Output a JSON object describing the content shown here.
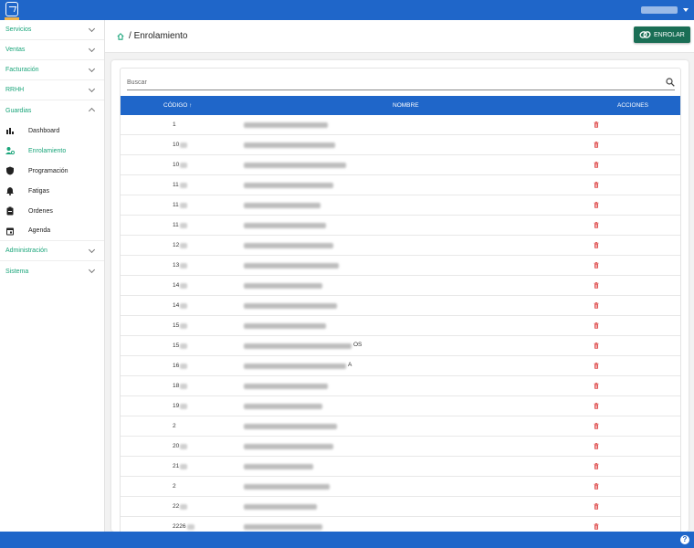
{
  "topbar": {
    "logo": "app-logo",
    "user_menu": "user-menu"
  },
  "sidebar": {
    "items": [
      {
        "label": "Servicios",
        "expanded": false
      },
      {
        "label": "Ventas",
        "expanded": false
      },
      {
        "label": "Facturación",
        "expanded": false
      },
      {
        "label": "RRHH",
        "expanded": false
      },
      {
        "label": "Guardias",
        "expanded": true
      },
      {
        "label": "Administración",
        "expanded": false
      },
      {
        "label": "Sistema",
        "expanded": false
      }
    ],
    "guardias_sub": [
      {
        "label": "Dashboard",
        "icon": "bar-chart-icon"
      },
      {
        "label": "Enrolamiento",
        "icon": "user-link-icon",
        "active": true
      },
      {
        "label": "Programación",
        "icon": "shield-icon"
      },
      {
        "label": "Fatigas",
        "icon": "bell-icon"
      },
      {
        "label": "Ordenes",
        "icon": "clipboard-icon"
      },
      {
        "label": "Agenda",
        "icon": "calendar-icon"
      }
    ]
  },
  "header": {
    "separator": "/",
    "title": "Enrolamiento",
    "button_label": "ENROLAR",
    "button_icon": "link-icon"
  },
  "search": {
    "placeholder": "Buscar"
  },
  "table": {
    "headers": {
      "code": "CÓDIGO ↑",
      "name": "NOMBRE",
      "actions": "ACCIONES"
    },
    "rows": [
      {
        "code": "1",
        "name_tail": ""
      },
      {
        "code": "10",
        "name_tail": ""
      },
      {
        "code": "10",
        "name_tail": ""
      },
      {
        "code": "11",
        "name_tail": ""
      },
      {
        "code": "11",
        "name_tail": ""
      },
      {
        "code": "11",
        "name_tail": ""
      },
      {
        "code": "12",
        "name_tail": ""
      },
      {
        "code": "13",
        "name_tail": ""
      },
      {
        "code": "14",
        "name_tail": ""
      },
      {
        "code": "14",
        "name_tail": ""
      },
      {
        "code": "15",
        "name_tail": ""
      },
      {
        "code": "15",
        "name_tail": "OS"
      },
      {
        "code": "16",
        "name_tail": "A"
      },
      {
        "code": "18",
        "name_tail": ""
      },
      {
        "code": "19",
        "name_tail": ""
      },
      {
        "code": "2",
        "name_tail": ""
      },
      {
        "code": "20",
        "name_tail": ""
      },
      {
        "code": "21",
        "name_tail": ""
      },
      {
        "code": "2",
        "name_tail": ""
      },
      {
        "code": "22",
        "name_tail": ""
      },
      {
        "code": "2226",
        "name_tail": ""
      }
    ]
  },
  "colors": {
    "primary": "#1f66c9",
    "accent": "#1aa57a",
    "button": "#1a6e55",
    "delete": "#e05555"
  }
}
